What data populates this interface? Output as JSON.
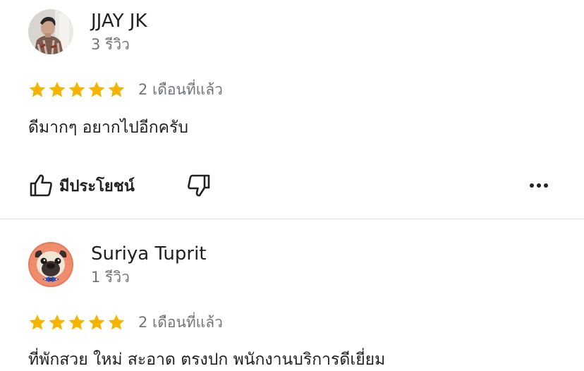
{
  "colors": {
    "star": "#F4B400",
    "text_primary": "#202124",
    "text_secondary": "#70757a",
    "divider": "#dadce0"
  },
  "reviews": [
    {
      "avatar_icon": "person-photo-avatar",
      "name": "JJAY JK",
      "review_count": "3 รีวิว",
      "rating": 5,
      "date": "2 เดือนที่แล้ว",
      "text": "ดีมากๆ อยากไปอีกครับ",
      "helpful_label": "มีประโยชน์"
    },
    {
      "avatar_icon": "pug-dog-avatar",
      "name": "Suriya Tuprit",
      "review_count": "1 รีวิว",
      "rating": 5,
      "date": "2 เดือนที่แล้ว",
      "text": "ที่พักสวย ใหม่ สะอาด ตรงปก พนักงานบริการดีเยี่ยม"
    }
  ]
}
